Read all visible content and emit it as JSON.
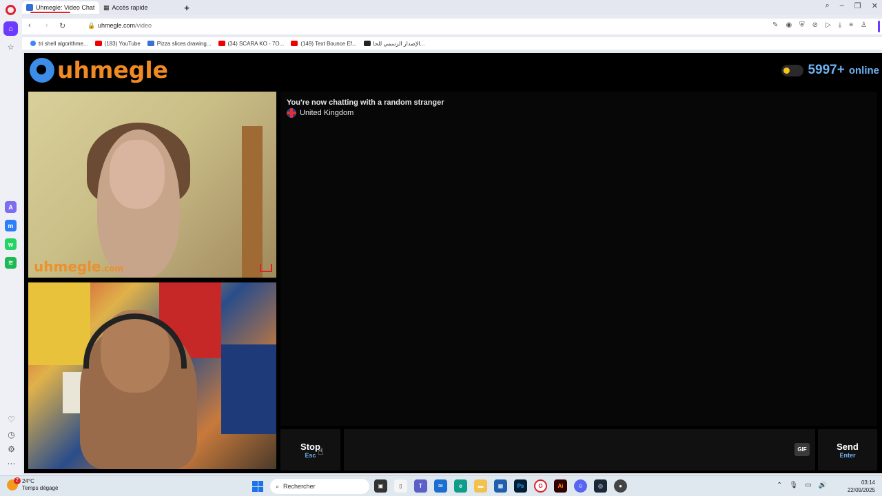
{
  "browser": {
    "tabs": [
      {
        "label": "Uhmegle: Video Chat"
      },
      {
        "label": "Accès rapide"
      }
    ],
    "url_domain": "uhmegle.com",
    "url_path": "/video",
    "bookmarks": [
      {
        "label": "tri shell algorithme...",
        "color": "#4285f4"
      },
      {
        "label": "(183) YouTube",
        "color": "#e00"
      },
      {
        "label": "Pizza slices drawing...",
        "color": "#3b6fd6"
      },
      {
        "label": "(34) SCARA KO - 7O...",
        "color": "#e00"
      },
      {
        "label": "(149) Text Bounce Ef...",
        "color": "#e00"
      },
      {
        "label": "الإصدار الرسمي للحا...",
        "color": "#222"
      }
    ]
  },
  "site": {
    "logo": "uhmegle",
    "online_count": "5997+",
    "online_label": "online",
    "watermark": "uhmegle",
    "watermark_tld": ".com",
    "chat_status": "You're now chatting with a random stranger",
    "country": "United Kingdom",
    "stop": {
      "label": "Stop",
      "shortcut": "Esc"
    },
    "gif_label": "GIF",
    "send": {
      "label": "Send",
      "shortcut": "Enter"
    },
    "message_placeholder": "",
    "accent_color": "#f08a22",
    "online_color": "#6fb2f2"
  },
  "taskbar": {
    "weather_badge": "2",
    "temperature": "24°C",
    "weather_desc": "Temps dégagé",
    "search_placeholder": "Rechercher",
    "time": "03:14",
    "date": "22/09/2025"
  }
}
